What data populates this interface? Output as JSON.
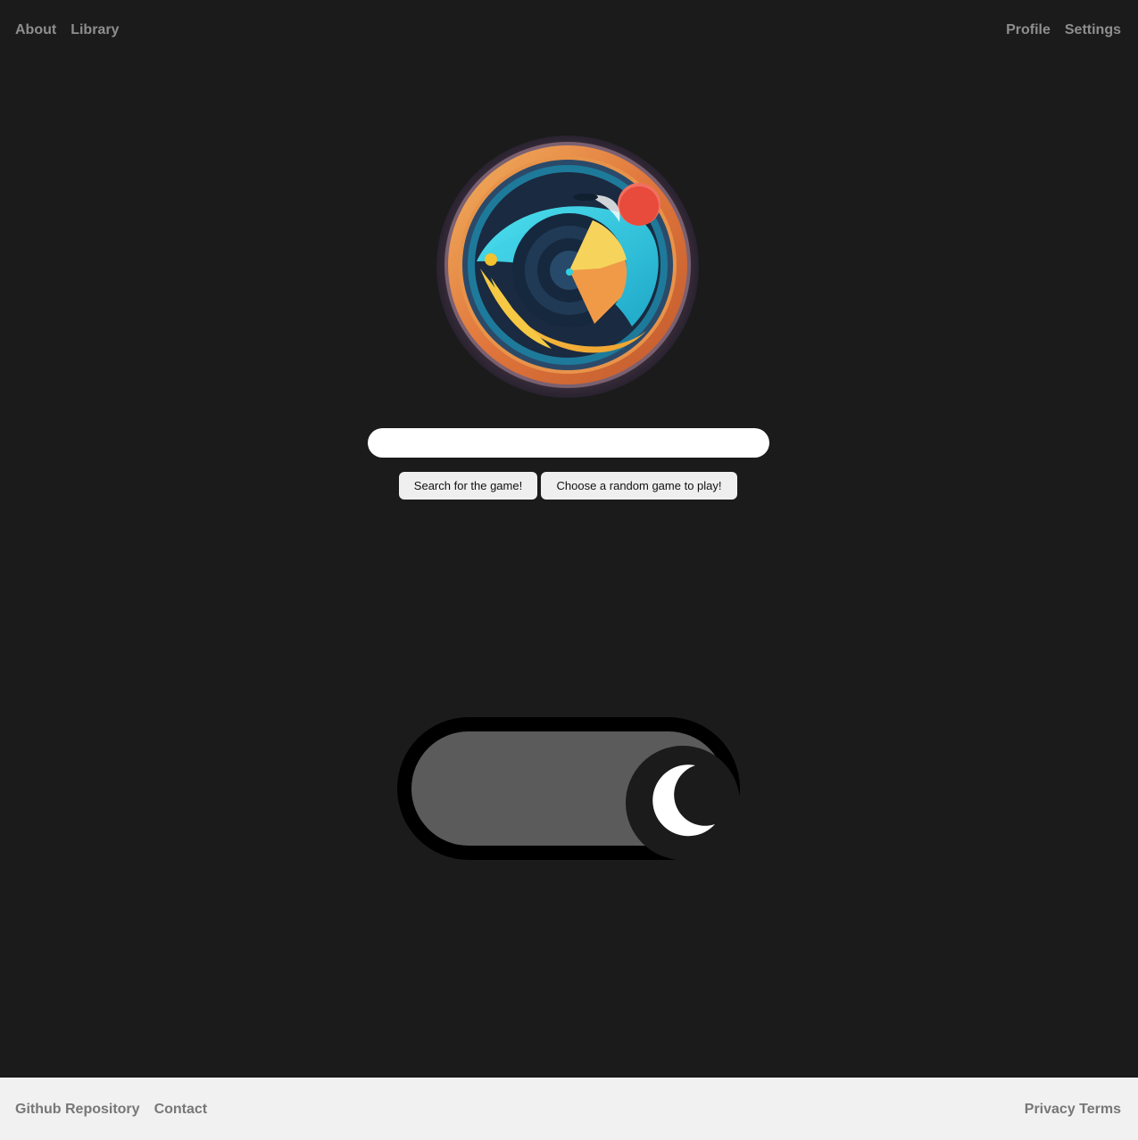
{
  "nav": {
    "left": [
      {
        "label": "About"
      },
      {
        "label": "Library"
      }
    ],
    "right": [
      {
        "label": "Profile"
      },
      {
        "label": "Settings"
      }
    ]
  },
  "logo": {
    "icon": "game-logo-fish-target"
  },
  "search": {
    "value": "",
    "placeholder": ""
  },
  "buttons": {
    "search_label": "Search for the game!",
    "random_label": "Choose a random game to play!"
  },
  "theme_toggle": {
    "state": "dark",
    "icon": "moon-icon"
  },
  "footer": {
    "left": [
      {
        "label": "Github Repository"
      },
      {
        "label": "Contact"
      }
    ],
    "right_label": "Privacy Terms"
  },
  "colors": {
    "background": "#1a1b1a",
    "nav_text": "#8e8e8e",
    "footer_bg": "#f1f1f1",
    "footer_text": "#777777",
    "toggle_track": "#5b5b5b"
  }
}
